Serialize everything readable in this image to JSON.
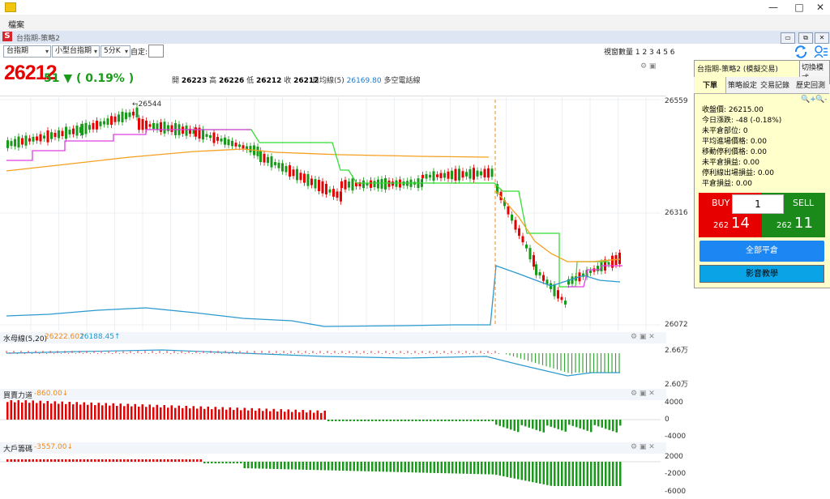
{
  "window": {
    "min_icon": "—",
    "max_icon": "□",
    "close_icon": "✕"
  },
  "menu": {
    "file": "檔案"
  },
  "mdi": {
    "title": "台指期-策略2",
    "app_icon": "S",
    "btn1": "▭",
    "btn2": "⧉",
    "btn3": "✕"
  },
  "toolbar": {
    "product": "台指期",
    "contract": "小型台指期",
    "period": "5分K",
    "custom_label": "自定:",
    "view_count": "視窗數量 1 2 3 4 5 6"
  },
  "quote": {
    "price": "26212",
    "change": "51 ▼ ( 0.19% )",
    "open_label": "開",
    "open": "26223",
    "high_label": "高",
    "high": "26226",
    "low_label": "低",
    "low": "26212",
    "close_label": "收",
    "close": "26212",
    "ma_label": "日均線(5)",
    "ma_value": "26169.80",
    "signal": "多空電話線"
  },
  "main_chart": {
    "y_labels": [
      "26559",
      "26316",
      "26072"
    ],
    "peak_label": "←26544"
  },
  "panels": [
    {
      "name": "水母線(5,20)",
      "v1": "26222.60↑",
      "v2": "26188.45↑",
      "y_labels": [
        "2.66万",
        "2.60万"
      ]
    },
    {
      "name": "買賣力道",
      "v1": "-860.00↓",
      "y_labels": [
        "4000",
        "0",
        "-4000"
      ]
    },
    {
      "name": "大戶籌碼",
      "v1": "-3557.00↓",
      "y_labels": [
        "2000",
        "-2000",
        "-6000"
      ]
    }
  ],
  "side": {
    "title": "台指期-策略2 (模擬交易)",
    "switch_mode": "切換模式",
    "tabs": [
      "下單",
      "策略設定",
      "交易記錄",
      "歷史回測"
    ],
    "stats": [
      "收盤價: 26215.00",
      "今日漲跌: -48 (-0.18%)",
      "未平倉部位: 0",
      "平均進場價格: 0.00",
      "移動停利價格: 0.00",
      "未平倉損益: 0.00",
      "停利線出場損益: 0.00",
      "平倉損益: 0.00"
    ],
    "buy_label": "BUY",
    "qty": "1",
    "sell_label": "SELL",
    "buy_prefix": "262",
    "buy_price": "14",
    "sell_prefix": "262",
    "sell_price": "11",
    "close_all": "全部平倉",
    "video": "影音教學",
    "zoom_in": "🔍+",
    "zoom_out": "🔍-"
  },
  "colors": {
    "up": "#e60000",
    "down": "#1a9a1a",
    "accent": "#1c86f2"
  }
}
